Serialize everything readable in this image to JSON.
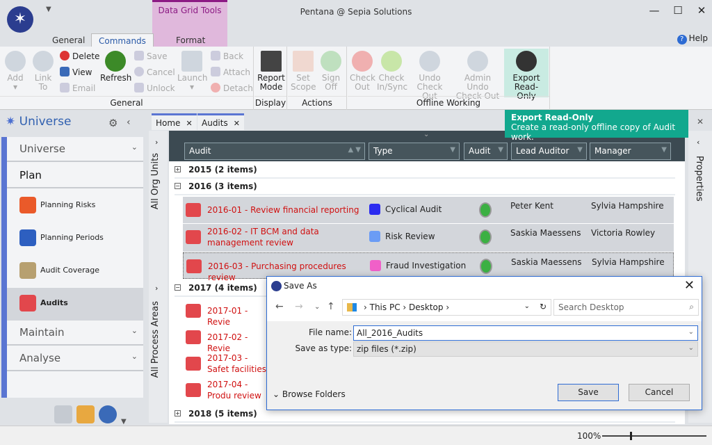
{
  "window": {
    "title": "Pentana @ Sepia Solutions",
    "min": "—",
    "max": "☐",
    "close": "✕"
  },
  "ribbon": {
    "context_group": "Data Grid Tools",
    "tabs": [
      "General",
      "Commands",
      "Format"
    ],
    "help": "Help",
    "groups": {
      "general": {
        "label": "General",
        "add": "Add",
        "link_to": "Link To",
        "delete": "Delete",
        "view": "View",
        "email": "Email",
        "refresh": "Refresh",
        "save": "Save",
        "cancel": "Cancel",
        "unlock": "Unlock",
        "launch": "Launch",
        "back": "Back",
        "attach": "Attach",
        "detach": "Detach"
      },
      "display": {
        "label": "Display",
        "report_mode": "Report Mode"
      },
      "actions": {
        "label": "Actions",
        "set_scope": "Set Scope",
        "sign_off": "Sign Off"
      },
      "offline": {
        "label": "Offline Working",
        "check_out": "Check Out",
        "check_in": "Check In/Sync",
        "undo": "Undo Check Out",
        "admin_undo": "Admin Undo Check Out",
        "export": "Export Read-Only"
      }
    }
  },
  "tooltip": {
    "title": "Export Read-Only",
    "text": "Create a read-only offline copy of Audit work."
  },
  "sidebar": {
    "title": "Universe",
    "sections": [
      "Universe",
      "Plan",
      "Maintain",
      "Analyse"
    ],
    "items": [
      {
        "label": "Planning Risks"
      },
      {
        "label": "Planning Periods"
      },
      {
        "label": "Audit Coverage"
      },
      {
        "label": "Audits"
      }
    ]
  },
  "doc_tabs": [
    "Home",
    "Audits"
  ],
  "side_labels": {
    "org": "All Org Units",
    "process": "All Process Areas",
    "properties": "Properties"
  },
  "grid": {
    "columns": [
      "Audit",
      "Type",
      "Audit",
      "Lead Auditor",
      "Manager"
    ],
    "groups": [
      "2015 (2 items)",
      "2016 (3 items)",
      "2017 (4 items)",
      "2018 (5 items)"
    ],
    "rows2016": [
      {
        "title": "2016-01 - Review financial reporting",
        "type": "Cyclical Audit",
        "color": "#2b2bf0",
        "lead": "Peter Kent",
        "manager": "Sylvia Hampshire"
      },
      {
        "title": "2016-02 - IT BCM and data management review",
        "type": "Risk Review",
        "color": "#6b9cf5",
        "lead": "Saskia Maessens",
        "manager": "Victoria Rowley"
      },
      {
        "title": "2016-03 - Purchasing procedures review",
        "type": "Fraud Investigation",
        "color": "#f060c8",
        "lead": "Saskia Maessens",
        "manager": "Sylvia Hampshire"
      }
    ],
    "rows2017": [
      "2017-01 - Revie",
      "2017-02 - Revie",
      "2017-03 - Safet facilities",
      "2017-04 - Produ review"
    ]
  },
  "status": {
    "zoom": "100%",
    "zoom_level": 100
  },
  "dialog": {
    "title": "Save As",
    "path": [
      "This PC",
      "Desktop"
    ],
    "search_placeholder": "Search Desktop",
    "file_name_label": "File name:",
    "file_name": "All_2016_Audits",
    "type_label": "Save as type:",
    "type": "zip files (*.zip)",
    "browse": "Browse Folders",
    "save": "Save",
    "cancel": "Cancel"
  }
}
